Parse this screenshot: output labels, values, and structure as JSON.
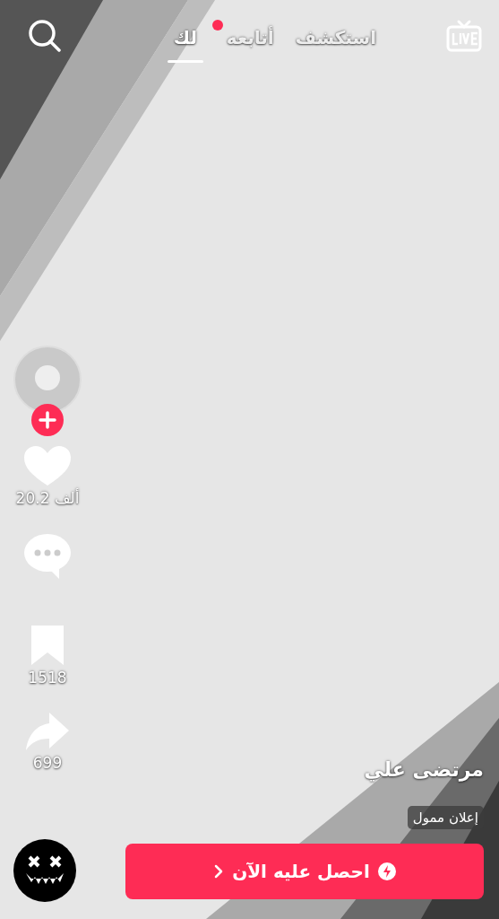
{
  "top_bar": {
    "tabs": [
      {
        "label": "استكشف",
        "selected": false,
        "has_dot": false
      },
      {
        "label": "أتابعه",
        "selected": false,
        "has_dot": true
      },
      {
        "label": "لك",
        "selected": true,
        "has_dot": false
      }
    ]
  },
  "actions": {
    "avatar": {
      "following": false
    },
    "like": {
      "count": "20.2 ألف",
      "liked": false
    },
    "bookmark": {
      "count": "1518"
    },
    "share": {
      "count": "699"
    }
  },
  "info": {
    "username": "مرتضى علي",
    "sponsored_label": "إعلان ممول",
    "cta": "احصل عليه الآن"
  }
}
